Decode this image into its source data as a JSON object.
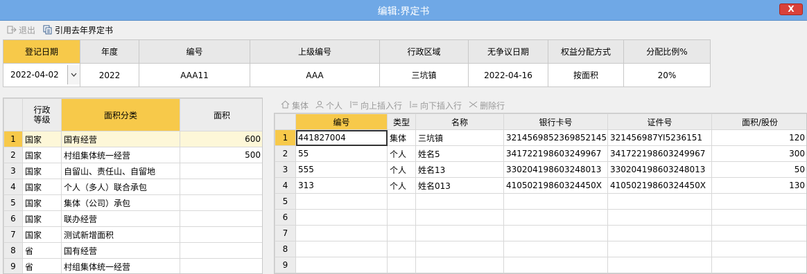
{
  "window": {
    "title": "编辑:界定书",
    "close_label": "X"
  },
  "toolbar": {
    "exit_label": "退出",
    "ref_label": "引用去年界定书"
  },
  "header": {
    "columns": [
      "登记日期",
      "年度",
      "编号",
      "上级编号",
      "行政区域",
      "无争议日期",
      "权益分配方式",
      "分配比例%"
    ],
    "values": {
      "date": "2022-04-02",
      "year": "2022",
      "code": "AAA11",
      "parent_code": "AAA",
      "region": "三坑镇",
      "undisputed_date": "2022-04-16",
      "distribution": "按面积",
      "ratio": "20%"
    }
  },
  "left_grid": {
    "columns": [
      "行政等级",
      "面积分类",
      "面积"
    ],
    "col_level_line1": "行政",
    "col_level_line2": "等级",
    "rows": [
      {
        "n": "1",
        "level": "国家",
        "category": "国有经营",
        "area": "600"
      },
      {
        "n": "2",
        "level": "国家",
        "category": "村组集体统一经营",
        "area": "500"
      },
      {
        "n": "3",
        "level": "国家",
        "category": "自留山、责任山、自留地",
        "area": ""
      },
      {
        "n": "4",
        "level": "国家",
        "category": "个人（多人）联合承包",
        "area": ""
      },
      {
        "n": "5",
        "level": "国家",
        "category": "集体（公司）承包",
        "area": ""
      },
      {
        "n": "6",
        "level": "国家",
        "category": "联办经营",
        "area": ""
      },
      {
        "n": "7",
        "level": "国家",
        "category": "测试新增面积",
        "area": ""
      },
      {
        "n": "8",
        "level": "省",
        "category": "国有经营",
        "area": ""
      },
      {
        "n": "9",
        "level": "省",
        "category": "村组集体统一经营",
        "area": ""
      }
    ]
  },
  "right_toolbar": {
    "collective": "集体",
    "individual": "个人",
    "insert_above": "向上插入行",
    "insert_below": "向下插入行",
    "delete_row": "删除行"
  },
  "right_grid": {
    "columns": [
      "编号",
      "类型",
      "名称",
      "银行卡号",
      "证件号",
      "面积/股份"
    ],
    "rows": [
      {
        "n": "1",
        "code": "441827004",
        "type": "集体",
        "name": "三坑镇",
        "bank": "3214569852369852145",
        "id": "321456987YI5236151",
        "share": "120"
      },
      {
        "n": "2",
        "code": "55",
        "type": "个人",
        "name": "姓名5",
        "bank": "341722198603249967",
        "id": "341722198603249967",
        "share": "300"
      },
      {
        "n": "3",
        "code": "555",
        "type": "个人",
        "name": "姓名13",
        "bank": "330204198603248013",
        "id": "330204198603248013",
        "share": "50"
      },
      {
        "n": "4",
        "code": "313",
        "type": "个人",
        "name": "姓名013",
        "bank": "41050219860324450X",
        "id": "41050219860324450X",
        "share": "130"
      },
      {
        "n": "5",
        "code": "",
        "type": "",
        "name": "",
        "bank": "",
        "id": "",
        "share": ""
      },
      {
        "n": "6",
        "code": "",
        "type": "",
        "name": "",
        "bank": "",
        "id": "",
        "share": ""
      },
      {
        "n": "7",
        "code": "",
        "type": "",
        "name": "",
        "bank": "",
        "id": "",
        "share": ""
      },
      {
        "n": "8",
        "code": "",
        "type": "",
        "name": "",
        "bank": "",
        "id": "",
        "share": ""
      },
      {
        "n": "9",
        "code": "",
        "type": "",
        "name": "",
        "bank": "",
        "id": "",
        "share": ""
      }
    ]
  },
  "colors": {
    "title_bar": "#6fa8e6",
    "accent": "#f7c94a",
    "close": "#d9413a"
  }
}
